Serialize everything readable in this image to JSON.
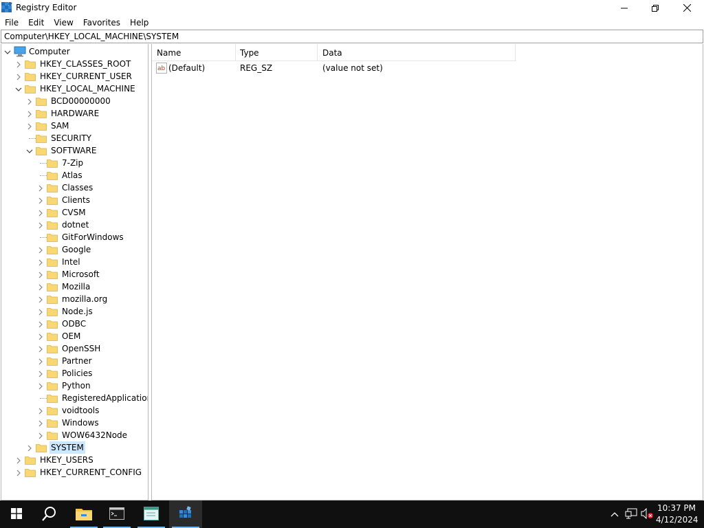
{
  "window": {
    "title": "Registry Editor",
    "minimize_icon": "minimize-icon",
    "restore_icon": "restore-icon",
    "close_icon": "close-icon"
  },
  "menu": [
    "File",
    "Edit",
    "View",
    "Favorites",
    "Help"
  ],
  "address": "Computer\\HKEY_LOCAL_MACHINE\\SYSTEM",
  "tree": {
    "root": "Computer",
    "hives": {
      "classes_root": "HKEY_CLASSES_ROOT",
      "current_user": "HKEY_CURRENT_USER",
      "local_machine": "HKEY_LOCAL_MACHINE",
      "users": "HKEY_USERS",
      "current_config": "HKEY_CURRENT_CONFIG"
    },
    "hklm_children": [
      "BCD00000000",
      "HARDWARE",
      "SAM",
      "SECURITY",
      "SOFTWARE",
      "SYSTEM"
    ],
    "software_children": [
      "7-Zip",
      "Atlas",
      "Classes",
      "Clients",
      "CVSM",
      "dotnet",
      "GitForWindows",
      "Google",
      "Intel",
      "Microsoft",
      "Mozilla",
      "mozilla.org",
      "Node.js",
      "ODBC",
      "OEM",
      "OpenSSH",
      "Partner",
      "Policies",
      "Python",
      "RegisteredApplications",
      "voidtools",
      "Windows",
      "WOW6432Node"
    ],
    "selected": "SYSTEM"
  },
  "list": {
    "columns": [
      "Name",
      "Type",
      "Data"
    ],
    "rows": [
      {
        "name": "(Default)",
        "type": "REG_SZ",
        "data": "(value not set)",
        "icon": "string-value-icon"
      }
    ]
  },
  "taskbar": {
    "time": "10:37 PM",
    "date": "4/12/2024",
    "accent": "#76b9ed",
    "background": "#101010"
  },
  "colors": {
    "selection": "#cce8ff",
    "folder": "#f8d775"
  }
}
